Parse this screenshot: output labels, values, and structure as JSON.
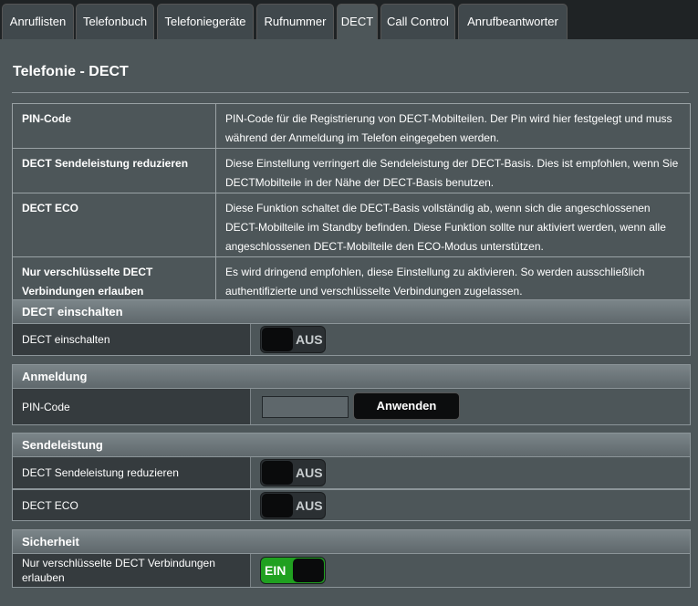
{
  "tabs": [
    "Anruflisten",
    "Telefonbuch",
    "Telefoniegeräte",
    "Rufnummer",
    "DECT",
    "Call Control",
    "Anrufbeantworter"
  ],
  "page_title": "Telefonie - DECT",
  "descriptions": [
    {
      "key": "PIN-Code",
      "text": "PIN-Code für die Registrierung von DECT-Mobilteilen. Der Pin wird hier festgelegt und muss während der Anmeldung im Telefon eingegeben werden."
    },
    {
      "key": "DECT Sendeleistung reduzieren",
      "text": "Diese Einstellung verringert die Sendeleistung der DECT-Basis. Dies ist empfohlen, wenn Sie DECTMobilteile in der Nähe der DECT-Basis benutzen."
    },
    {
      "key": "DECT ECO",
      "text": "Diese Funktion schaltet die DECT-Basis vollständig ab, wenn sich die angeschlossenen DECT-Mobilteile im Standby befinden. Diese Funktion sollte nur aktiviert werden, wenn alle angeschlossenen DECT-Mobilteile den ECO-Modus unterstützen."
    },
    {
      "key": "Nur verschlüsselte DECT Verbindungen erlauben",
      "text": "Es wird dringend empfohlen, diese Einstellung zu aktivieren. So werden ausschließlich authentifizierte und verschlüsselte Verbindungen zugelassen."
    }
  ],
  "sections": {
    "dect": {
      "title": "DECT einschalten",
      "label": "DECT einschalten",
      "toggle": "AUS"
    },
    "anmeldung": {
      "title": "Anmeldung",
      "label": "PIN-Code",
      "pin_value": "",
      "apply": "Anwenden"
    },
    "sendeleistung": {
      "title": "Sendeleistung",
      "reduce_label": "DECT Sendeleistung reduzieren",
      "reduce_toggle": "AUS",
      "eco_label": "DECT ECO",
      "eco_toggle": "AUS"
    },
    "sicherheit": {
      "title": "Sicherheit",
      "label": "Nur verschlüsselte DECT Verbindungen erlauben",
      "toggle": "EIN"
    }
  },
  "colors": {
    "accent_on": "#20a020",
    "panel": "#4d5659",
    "label_bg": "#353b3e"
  }
}
